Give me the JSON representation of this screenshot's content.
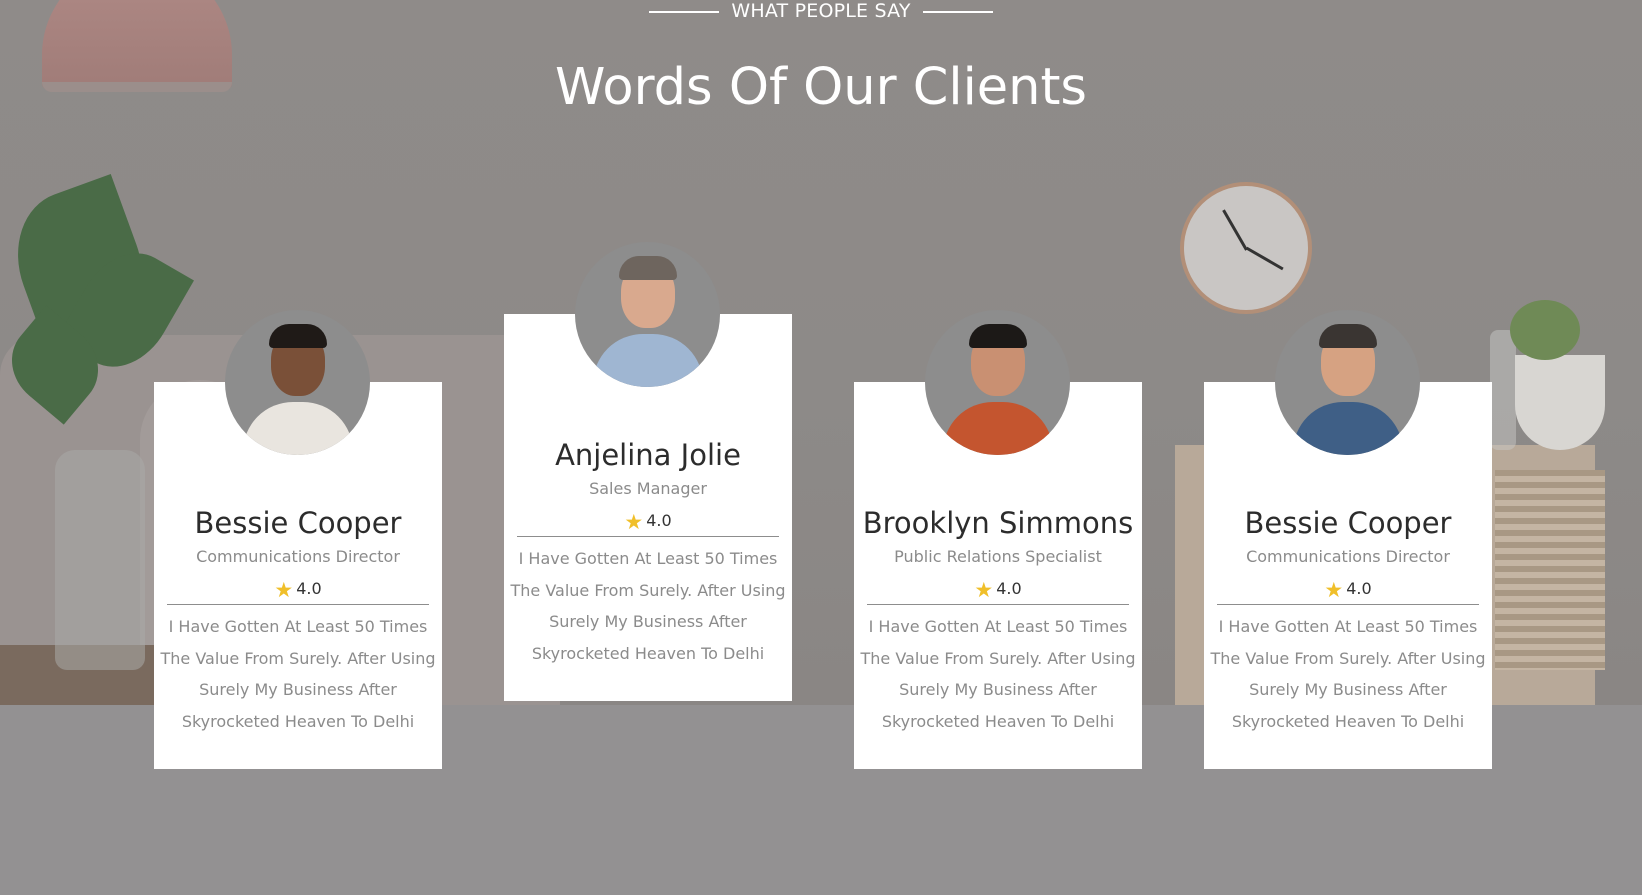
{
  "section": {
    "kicker": "WHAT PEOPLE SAY",
    "title": "Words Of Our Clients"
  },
  "colors": {
    "star": "#f0bf2a",
    "card_bg": "#ffffff",
    "overlay": "#939192"
  },
  "testimonials": [
    {
      "name": "Bessie Cooper",
      "role": "Communications Director",
      "rating": "4.0",
      "star_icon": "star-icon",
      "text": "I Have Gotten At Least 50 Times The Value From Surely. After Using Surely My Business After Skyrocketed Heaven To Delhi"
    },
    {
      "name": "Anjelina Jolie",
      "role": "Sales Manager",
      "rating": "4.0",
      "star_icon": "star-icon",
      "text": "I Have Gotten At Least 50 Times The Value From Surely. After Using Surely My Business After Skyrocketed Heaven To Delhi"
    },
    {
      "name": "Brooklyn Simmons",
      "role": "Public Relations Specialist",
      "rating": "4.0",
      "star_icon": "star-icon",
      "text": "I Have Gotten At Least 50 Times The Value From Surely. After Using Surely My Business After Skyrocketed Heaven To Delhi"
    },
    {
      "name": "Bessie Cooper",
      "role": "Communications Director",
      "rating": "4.0",
      "star_icon": "star-icon",
      "text": "I Have Gotten At Least 50 Times The Value From Surely. After Using Surely My Business After Skyrocketed Heaven To Delhi"
    }
  ]
}
